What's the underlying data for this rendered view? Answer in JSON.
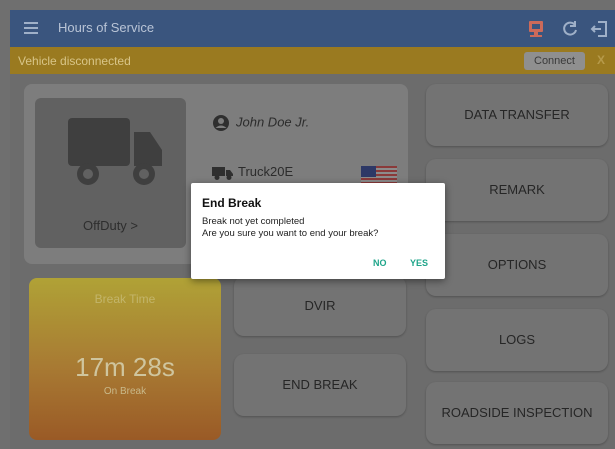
{
  "appbar": {
    "title": "Hours of Service",
    "icons": [
      "menu-icon",
      "eld-device-icon",
      "refresh-icon",
      "logout-icon"
    ]
  },
  "status_bar": {
    "text": "Vehicle disconnected",
    "connect_label": "Connect",
    "close_label": "X"
  },
  "driver": {
    "name": "John Doe Jr.",
    "truck": "Truck20E",
    "duty_status": "OffDuty >"
  },
  "break": {
    "title": "Break Time",
    "time": "17m 28s",
    "subtitle": "On Break"
  },
  "buttons": {
    "data_transfer": "DATA TRANSFER",
    "remark": "REMARK",
    "options": "OPTIONS",
    "logs": "LOGS",
    "roadside": "ROADSIDE INSPECTION",
    "dvir": "DVIR",
    "end_break": "END BREAK"
  },
  "dialog": {
    "title": "End Break",
    "message_line1": "Break not yet completed",
    "message_line2": "Are you sure you want to end your break?",
    "no_label": "NO",
    "yes_label": "YES"
  },
  "colors": {
    "appbar": "#3a557e",
    "status_strip": "#9a7a20",
    "dialog_action": "#1fa58a",
    "break_card_top": "#b0a236",
    "break_card_bottom": "#9a5a26"
  }
}
